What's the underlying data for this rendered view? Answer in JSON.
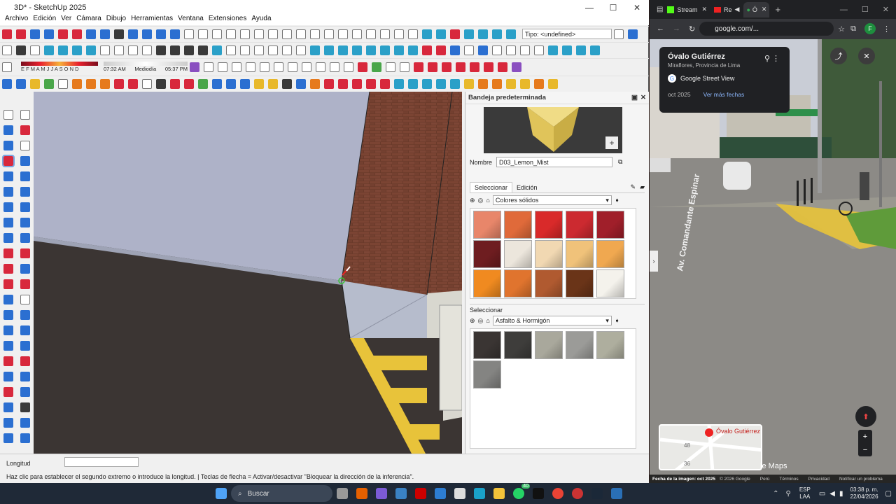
{
  "sketchup": {
    "window_title": "3D* - SketchUp 2025",
    "menu": [
      "Archivo",
      "Edición",
      "Ver",
      "Cámara",
      "Dibujo",
      "Herramientas",
      "Ventana",
      "Extensiones",
      "Ayuda"
    ],
    "type_field": "Tipo: <undefined>",
    "months": "E F M A M J J A S O N D",
    "time_start": "07:32 AM",
    "time_mid": "Mediodía",
    "time_end": "05:37 PM",
    "tray": {
      "title": "Bandeja predeterminada",
      "name_label": "Nombre",
      "name_value": "D03_Lemon_Mist",
      "tab_select": "Seleccionar",
      "tab_edit": "Edición",
      "library1": "Colores sólidos",
      "select2": "Seleccionar",
      "library2": "Asfalto & Hormigón",
      "swatches1": [
        "#e8866a",
        "#e06a3a",
        "#d92a2a",
        "#cc2a30",
        "#a01f2a",
        "#6e1d20",
        "#ece6dc",
        "#f1d8b2",
        "#f0c27a",
        "#f0a850",
        "#f08a20",
        "#e0742e",
        "#b05a30",
        "#6a3418",
        "#f4f2ec"
      ],
      "swatches2": [
        "#3a3533",
        "#3e3d3b",
        "#a9a89c",
        "#9b9b98",
        "#aeae9e",
        "#848482"
      ],
      "preview_color": "#e6cc6a"
    },
    "status": {
      "measure_label": "Longitud",
      "hint": "Haz clic para establecer el segundo extremo o introduce la longitud. | Teclas de flecha = Activar/desactivar \"Bloquear la dirección de la inferencia\"."
    }
  },
  "chrome": {
    "tabs": [
      "Stream",
      "Re",
      "Ó"
    ],
    "url": "google.com/...",
    "place_title": "Óvalo Gutiérrez",
    "place_sub": "Miraflores, Provincia de Lima",
    "sv_label": "Google Street View",
    "date": "oct 2025",
    "more_dates": "Ver más fechas",
    "street_name": "Av. Comandante Espinar",
    "mini_map_label": "Óvalo Gutiérrez",
    "mini_map_nums": [
      "48",
      "36"
    ],
    "maps_label": "le Maps",
    "footer": [
      "Fecha de la imagen: oct 2025",
      "© 2026 Google",
      "Perú",
      "Términos",
      "Privacidad",
      "Notificar un problema"
    ],
    "profile": "F"
  },
  "taskbar": {
    "search": "Buscar",
    "lang": "ESP",
    "lang2": "LAA",
    "time": "03:38 p. m.",
    "date": "22/04/2026",
    "badge": "40"
  }
}
